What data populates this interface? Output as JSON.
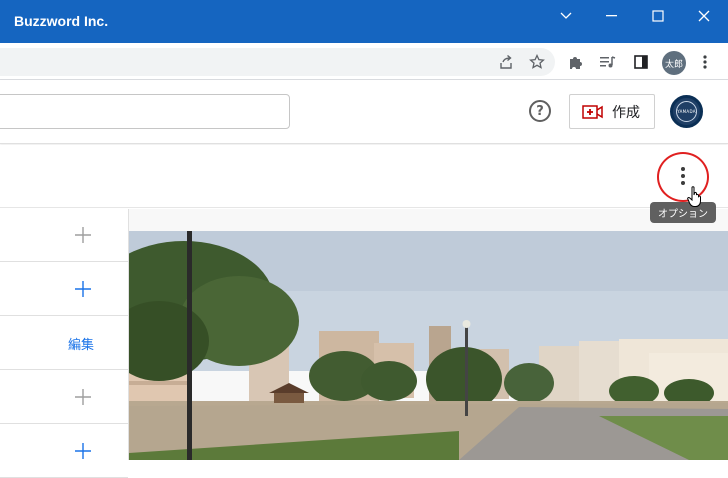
{
  "window": {
    "title": "Buzzword Inc.",
    "controls": [
      "chevron-down-icon",
      "minimize-icon",
      "maximize-icon",
      "close-icon"
    ]
  },
  "browser": {
    "toolbar_icons": [
      "share-icon",
      "star-icon",
      "extensions-icon",
      "media-icon",
      "side-panel-icon",
      "profile-avatar",
      "kebab-menu-icon"
    ],
    "profile_label": "太郎"
  },
  "header": {
    "search": {
      "value": "",
      "placeholder": ""
    },
    "help_icon": "question-circle-icon",
    "create_label": "作成",
    "create_icon": "video-add-icon",
    "avatar_text": "YAMADA"
  },
  "subheader": {
    "options_tooltip": "オプション",
    "options_icon": "vertical-dots-icon"
  },
  "sidebar": {
    "rows": [
      {
        "action": "plus",
        "color": "#9e9e9e"
      },
      {
        "action": "plus",
        "color": "#1a73e8"
      },
      {
        "action": "edit",
        "label": "編集",
        "color": "#1a73e8"
      },
      {
        "action": "plus",
        "color": "#9e9e9e"
      },
      {
        "action": "plus",
        "color": "#1a73e8"
      }
    ]
  },
  "colors": {
    "titlebar": "#1565c0",
    "accent": "#1a73e8",
    "highlight": "#e02020"
  }
}
